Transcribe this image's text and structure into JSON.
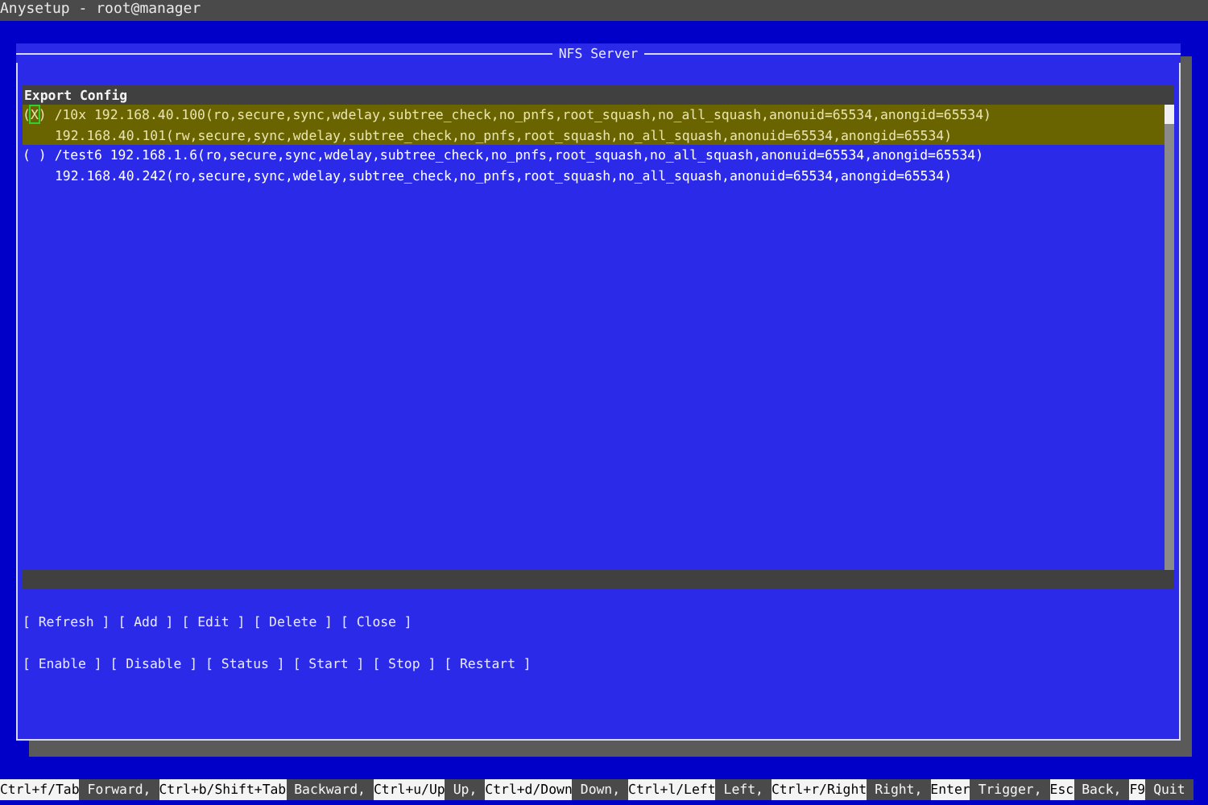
{
  "window": {
    "title": "Anysetup - root@manager"
  },
  "dialog": {
    "title": "NFS Server",
    "list": {
      "heading": "Export Config",
      "items": [
        {
          "marker": "(X)",
          "selected": true,
          "path": "/10x",
          "clients": [
            "192.168.40.100(ro,secure,sync,wdelay,subtree_check,no_pnfs,root_squash,no_all_squash,anonuid=65534,anongid=65534)",
            "192.168.40.101(rw,secure,sync,wdelay,subtree_check,no_pnfs,root_squash,no_all_squash,anonuid=65534,anongid=65534)"
          ]
        },
        {
          "marker": "( )",
          "selected": false,
          "path": "/test6",
          "clients": [
            "192.168.1.6(ro,secure,sync,wdelay,subtree_check,no_pnfs,root_squash,no_all_squash,anonuid=65534,anongid=65534)",
            "192.168.40.242(ro,secure,sync,wdelay,subtree_check,no_pnfs,root_squash,no_all_squash,anonuid=65534,anongid=65534)"
          ]
        }
      ]
    },
    "button_rows": [
      [
        "[ Refresh ]",
        "[ Add ]",
        "[ Edit ]",
        "[ Delete ]",
        "[ Close ]"
      ],
      [
        "[ Enable ]",
        "[ Disable ]",
        "[ Status ]",
        "[ Start ]",
        "[ Stop ]",
        "[ Restart ]"
      ]
    ]
  },
  "status_bar": [
    {
      "key": "Ctrl+f/Tab",
      "action": "Forward,"
    },
    {
      "key": "Ctrl+b/Shift+Tab",
      "action": "Backward,"
    },
    {
      "key": "Ctrl+u/Up",
      "action": "Up,"
    },
    {
      "key": "Ctrl+d/Down",
      "action": "Down,"
    },
    {
      "key": "Ctrl+l/Left",
      "action": "Left,"
    },
    {
      "key": "Ctrl+r/Right",
      "action": "Right,"
    },
    {
      "key": "Enter",
      "action": "Trigger,"
    },
    {
      "key": "Esc",
      "action": "Back,"
    },
    {
      "key": "F9",
      "action": "Quit"
    }
  ]
}
